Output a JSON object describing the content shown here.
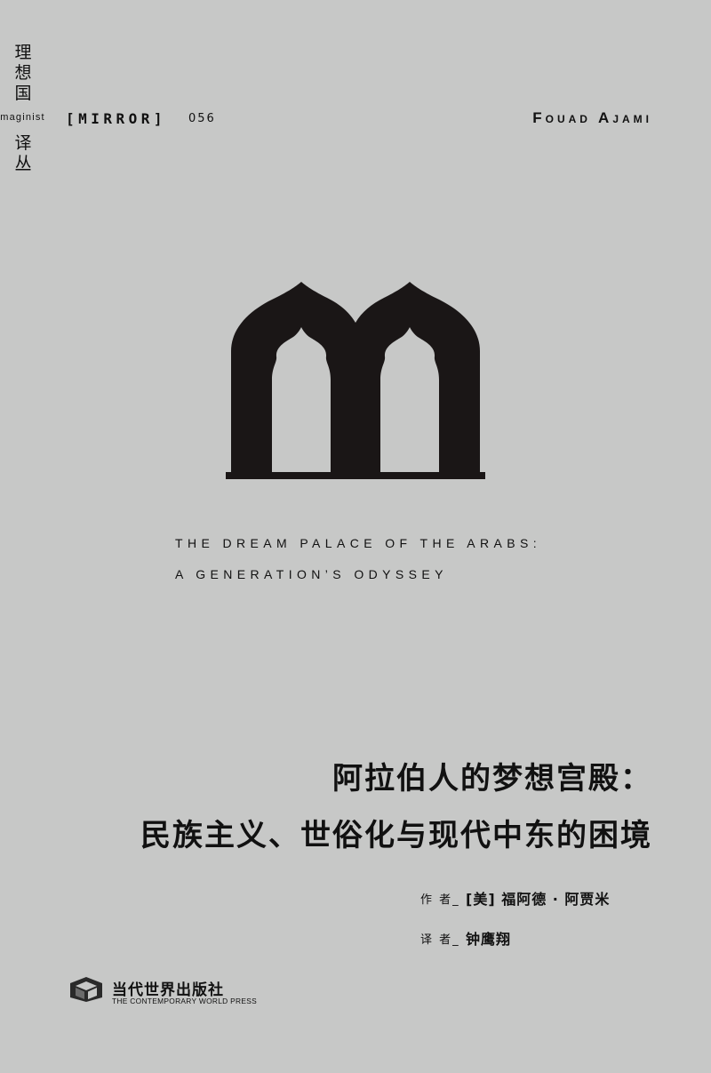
{
  "series": {
    "name_chars": [
      "理",
      "想",
      "国"
    ],
    "latin": "Imaginist",
    "sub_chars": [
      "译",
      "丛"
    ]
  },
  "header": {
    "imprint": "[MIRROR]",
    "number": "056",
    "author_en": "Fouad Ajami"
  },
  "logo": {
    "icon": "arch-m-icon",
    "color": "#1a1616"
  },
  "title_en": {
    "line1": "THE DREAM PALACE OF THE ARABS:",
    "line2": "A GENERATION’S ODYSSEY"
  },
  "title_zh": {
    "line1": "阿拉伯人的梦想宫殿：",
    "line2": "民族主义、世俗化与现代中东的困境"
  },
  "credits": {
    "author_role": "作 者_",
    "author_name": "[美] 福阿德 · 阿贾米",
    "translator_role": "译 者_",
    "translator_name": "钟鹰翔"
  },
  "publisher": {
    "icon": "publisher-cube-icon",
    "name_zh": "当代世界出版社",
    "name_en": "THE CONTEMPORARY WORLD PRESS"
  },
  "colors": {
    "background": "#c7c8c7",
    "ink": "#111111"
  }
}
